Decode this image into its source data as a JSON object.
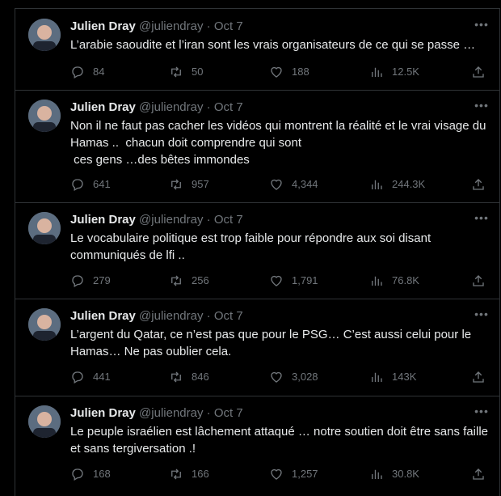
{
  "tweets": [
    {
      "name": "Julien Dray",
      "handle": "@juliendray",
      "separator": "·",
      "date": "Oct 7",
      "text": "L’arabie saoudite et l’iran sont les vrais organisateurs de ce qui se passe …",
      "replies": "84",
      "retweets": "50",
      "likes": "188",
      "views": "12.5K"
    },
    {
      "name": "Julien Dray",
      "handle": "@juliendray",
      "separator": "·",
      "date": "Oct 7",
      "text": "Non il ne faut pas cacher les vidéos qui montrent la réalité et le vrai visage du Hamas ..  chacun doit comprendre qui sont\n ces gens …des bêtes immondes",
      "replies": "641",
      "retweets": "957",
      "likes": "4,344",
      "views": "244.3K"
    },
    {
      "name": "Julien Dray",
      "handle": "@juliendray",
      "separator": "·",
      "date": "Oct 7",
      "text": "Le vocabulaire politique est trop faible pour répondre aux soi disant communiqués de lfi ..",
      "replies": "279",
      "retweets": "256",
      "likes": "1,791",
      "views": "76.8K"
    },
    {
      "name": "Julien Dray",
      "handle": "@juliendray",
      "separator": "·",
      "date": "Oct 7",
      "text": "L’argent du Qatar, ce n’est pas que pour le PSG… C’est aussi celui pour le Hamas… Ne pas oublier cela.",
      "replies": "441",
      "retweets": "846",
      "likes": "3,028",
      "views": "143K"
    },
    {
      "name": "Julien Dray",
      "handle": "@juliendray",
      "separator": "·",
      "date": "Oct 7",
      "text": "Le peuple israélien est lâchement attaqué … notre soutien doit être sans faille et sans tergiversation .!",
      "replies": "168",
      "retweets": "166",
      "likes": "1,257",
      "views": "30.8K"
    }
  ],
  "icons": {
    "more": "more-icon",
    "reply": "reply-icon",
    "retweet": "retweet-icon",
    "like": "heart-icon",
    "views": "views-icon",
    "share": "share-icon"
  },
  "colors": {
    "background": "#000000",
    "text": "#e7e9ea",
    "muted": "#71767b",
    "border": "#2f3336"
  }
}
